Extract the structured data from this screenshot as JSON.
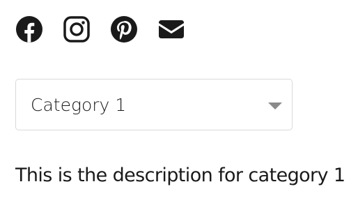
{
  "social": {
    "items": [
      {
        "icon": "facebook-icon",
        "label": "Facebook"
      },
      {
        "icon": "instagram-icon",
        "label": "Instagram"
      },
      {
        "icon": "pinterest-icon",
        "label": "Pinterest"
      },
      {
        "icon": "email-icon",
        "label": "Email"
      }
    ]
  },
  "category_select": {
    "value": "Category 1"
  },
  "description": {
    "text": "This is the description for category 1"
  },
  "colors": {
    "icon": "#1a1a1a",
    "text": "#1a1a1a",
    "border": "#d9d9d9",
    "caret": "#8a8a8a"
  }
}
